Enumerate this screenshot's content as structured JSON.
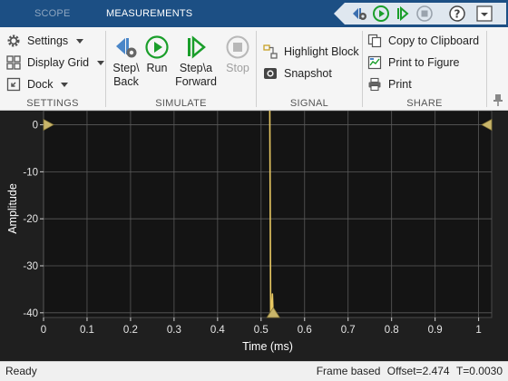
{
  "tabs": [
    {
      "label": "SCOPE"
    },
    {
      "label": "MEASUREMENTS"
    }
  ],
  "quickbar": {
    "icons": [
      "step-back-icon",
      "run-icon",
      "step-forward-icon",
      "stop-icon",
      "help-icon",
      "menu-icon"
    ]
  },
  "settings_section": {
    "title": "SETTINGS",
    "settings_label": "Settings",
    "display_grid_label": "Display Grid",
    "dock_label": "Dock"
  },
  "simulate_section": {
    "title": "SIMULATE",
    "step_back_label_1": "Step\\",
    "step_back_label_2": "Back",
    "run_label": "Run",
    "step_forward_label_1": "Step\\a",
    "step_forward_label_2": "Forward",
    "stop_label": "Stop"
  },
  "signal_section": {
    "title": "SIGNAL",
    "highlight_block_label": "Highlight Block",
    "snapshot_label": "Snapshot"
  },
  "share_section": {
    "title": "SHARE",
    "copy_label": "Copy to Clipboard",
    "print_figure_label": "Print to Figure",
    "print_label": "Print"
  },
  "colors": {
    "tabbar": "#1c4f84",
    "plot_background": "#1f1f1f",
    "grid": "#5a5a5a",
    "signal": "#e8c862",
    "marker": "#c9b56a",
    "run_green": "#1a9e2a"
  },
  "chart_data": {
    "type": "line",
    "xlabel": "Time (ms)",
    "ylabel": "Amplitude",
    "xlim": [
      0,
      1.03
    ],
    "ylim": [
      -41,
      3
    ],
    "grid": true,
    "xticks": [
      0,
      0.1,
      0.2,
      0.3,
      0.4,
      0.5,
      0.6,
      0.7,
      0.8,
      0.9,
      1
    ],
    "yticks": [
      0,
      -10,
      -20,
      -30,
      -40
    ],
    "series": [
      {
        "x": [
          0.52,
          0.522,
          0.524,
          0.526,
          0.528
        ],
        "y": [
          3,
          -40,
          -40,
          -36,
          -41
        ],
        "color": "#e8c862"
      }
    ],
    "markers": [
      {
        "x": 0.0,
        "y": 0,
        "shape": "triangle-right"
      },
      {
        "x": 1.03,
        "y": 0,
        "shape": "triangle-left"
      },
      {
        "x": 0.528,
        "y": -41,
        "shape": "triangle-up"
      }
    ]
  },
  "status": {
    "left": "Ready",
    "frame": "Frame based",
    "offset": "Offset=2.474",
    "time": "T=0.0030"
  }
}
